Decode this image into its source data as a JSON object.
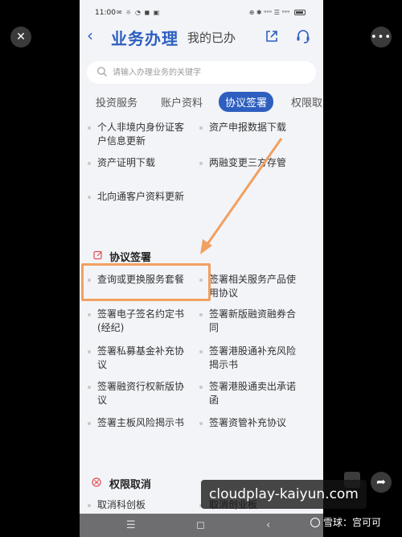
{
  "status_bar": {
    "time": "11:00",
    "icons_left": "✉ ☼ ◔ ◼ ▣",
    "icons_right": "⊕ ✱ ᵊᵊᵊ ☰ ᵊᵊᵊ"
  },
  "header": {
    "back_icon": "chevron-left-icon",
    "title": "业务办理",
    "subtitle": "我的已办",
    "share_icon": "share-icon",
    "support_icon": "headset-icon",
    "accent": "#2e5fbf"
  },
  "search": {
    "placeholder": "请输入办理业务的关键字"
  },
  "tabs": [
    {
      "label": "投资服务",
      "active": false
    },
    {
      "label": "账户资料",
      "active": false
    },
    {
      "label": "协议签署",
      "active": true
    },
    {
      "label": "权限取",
      "active": false
    }
  ],
  "upper_items": {
    "left": [
      {
        "line1": "个人非境内身份证客",
        "line2": "户信息更新"
      },
      {
        "line1": "资产证明下载",
        "line2": ""
      },
      {
        "line1": "北向通客户资料更新",
        "line2": ""
      }
    ],
    "right": [
      {
        "line1": "资产申报数据下载",
        "line2": ""
      },
      {
        "line1": "两融变更三方存管",
        "line2": ""
      }
    ]
  },
  "sections": {
    "agreement": {
      "title": "协议签署",
      "icon": "edit-icon",
      "items_left": [
        {
          "line1": "查询或更换服务套餐",
          "line2": ""
        },
        {
          "line1": "签署电子签名约定书",
          "line2": "(经纪)"
        },
        {
          "line1": "签署私募基金补充协",
          "line2": "议"
        },
        {
          "line1": "签署融资行权新版协",
          "line2": "议"
        },
        {
          "line1": "签署主板风险揭示书",
          "line2": ""
        }
      ],
      "items_right": [
        {
          "line1": "签署相关服务产品使",
          "line2": "用协议"
        },
        {
          "line1": "签署新版融资融券合",
          "line2": "同"
        },
        {
          "line1": "签署港股通补充风险",
          "line2": "揭示书"
        },
        {
          "line1": "签署港股通卖出承诺",
          "line2": "函"
        },
        {
          "line1": "签署资管补充协议",
          "line2": ""
        }
      ]
    },
    "revoke": {
      "title": "权限取消",
      "icon": "cancel-circle-icon",
      "items_left": [
        {
          "line1": "取消科创板",
          "line2": ""
        }
      ],
      "items_right": [
        {
          "line1": "取消创业板",
          "line2": ""
        }
      ]
    }
  },
  "highlight": {
    "color": "#f0a060"
  },
  "overlay": {
    "close_icon": "close-icon",
    "more_icon": "more-icon",
    "share_icon": "share-arrow-icon",
    "watermark": "cloudplay-kaiyun.com",
    "credit": "雪球：宫可可"
  },
  "navbar": {
    "menu_icon": "menu-icon",
    "home_icon": "home-icon",
    "back_icon": "back-icon"
  }
}
